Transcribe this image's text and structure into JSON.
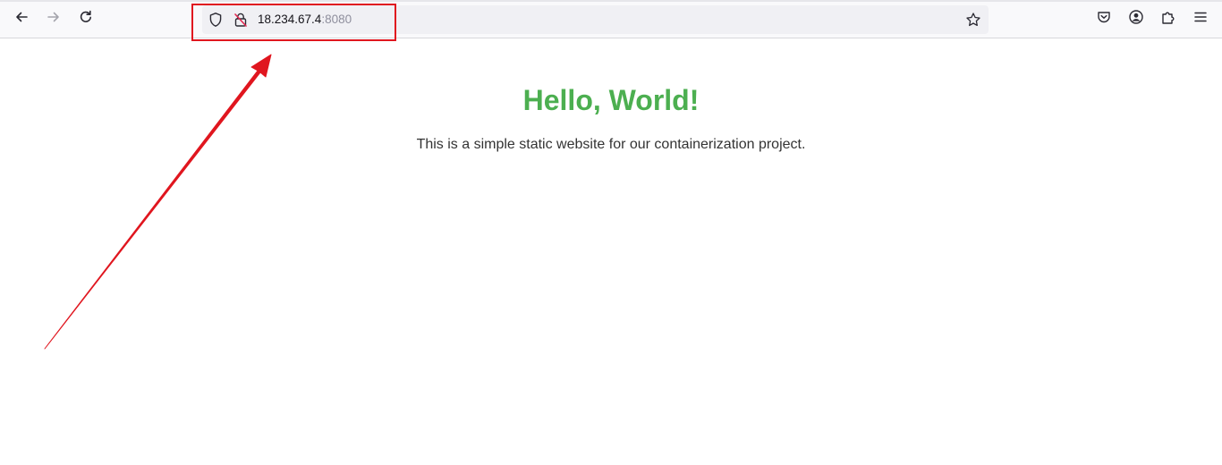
{
  "browser": {
    "url": {
      "host": "18.234.67.4",
      "port": ":8080"
    },
    "icons": {
      "back": "back-arrow-icon",
      "forward": "forward-arrow-icon",
      "reload": "reload-icon",
      "tracking_protection": "shield-icon",
      "connection": "insecure-lock-icon",
      "bookmark": "star-icon",
      "pocket": "pocket-icon",
      "account": "account-icon",
      "extensions": "puzzle-icon",
      "menu": "hamburger-menu-icon"
    }
  },
  "page": {
    "heading": "Hello, World!",
    "paragraph": "This is a simple static website for our containerization project."
  },
  "colors": {
    "heading": "#4caf50",
    "annotation": "#e0161f"
  }
}
